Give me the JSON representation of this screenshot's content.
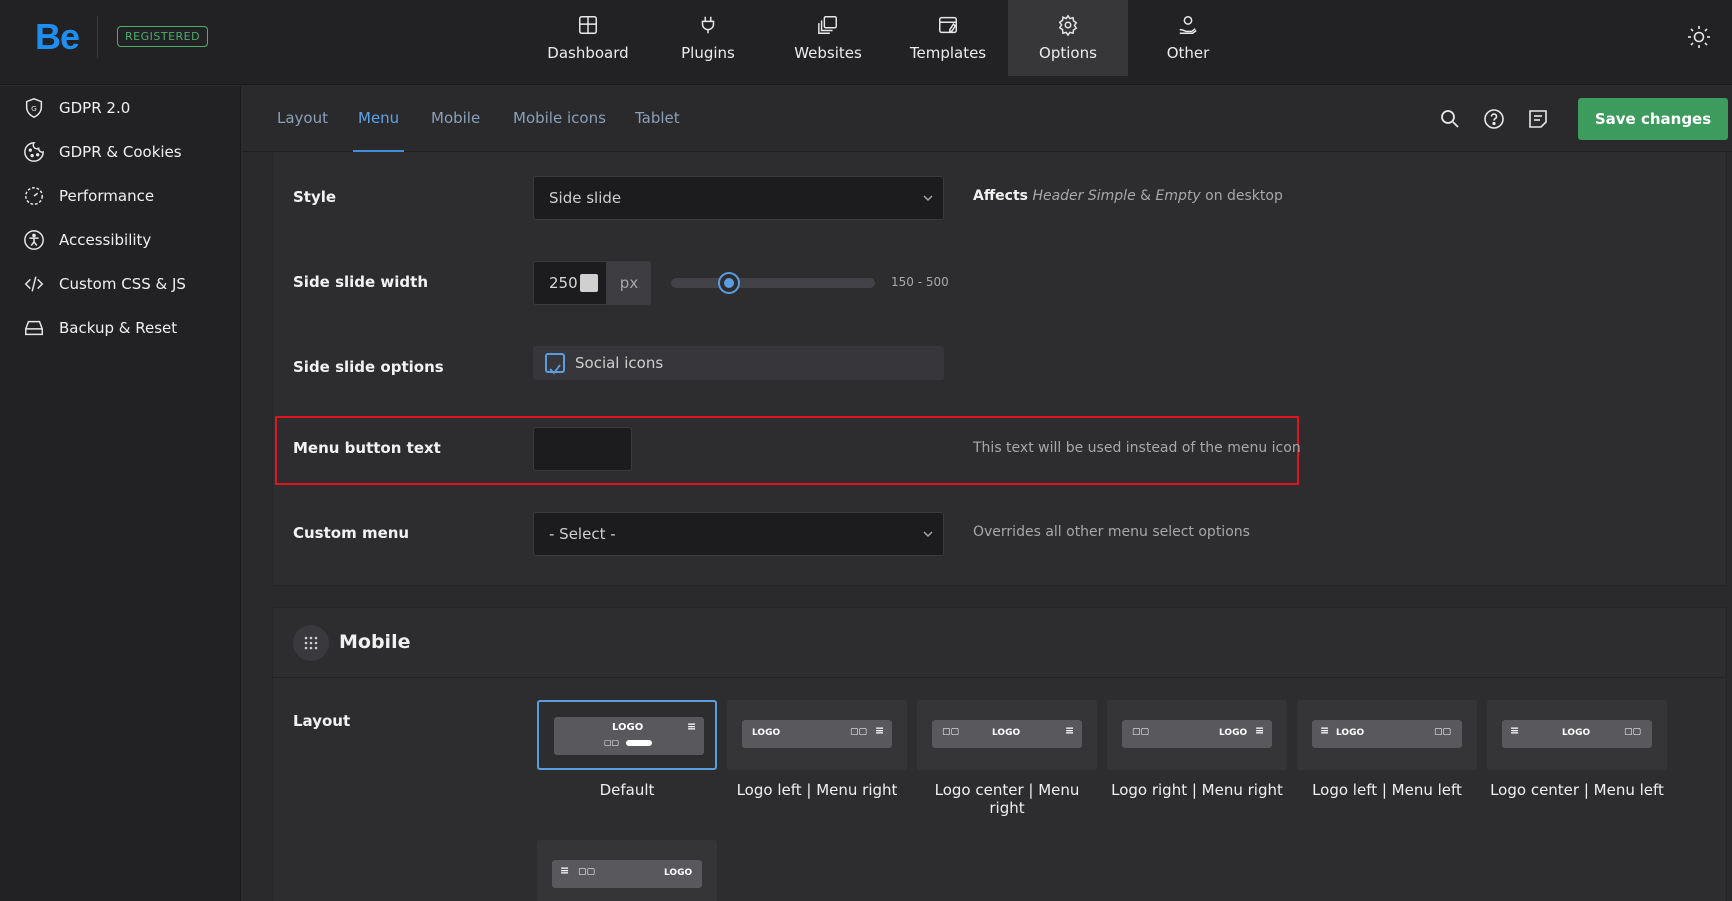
{
  "brand": {
    "logo": "Be",
    "badge": "REGISTERED"
  },
  "nav": [
    {
      "label": "Dashboard",
      "icon": "dashboard-icon"
    },
    {
      "label": "Plugins",
      "icon": "plug-icon"
    },
    {
      "label": "Websites",
      "icon": "websites-icon"
    },
    {
      "label": "Templates",
      "icon": "templates-icon"
    },
    {
      "label": "Options",
      "icon": "gear-icon",
      "active": true
    },
    {
      "label": "Other",
      "icon": "user-hand-icon"
    }
  ],
  "sidebar": [
    {
      "label": "GDPR 2.0",
      "icon": "shield-g-icon"
    },
    {
      "label": "GDPR & Cookies",
      "icon": "cookie-icon"
    },
    {
      "label": "Performance",
      "icon": "gauge-icon"
    },
    {
      "label": "Accessibility",
      "icon": "accessibility-icon"
    },
    {
      "label": "Custom CSS & JS",
      "icon": "code-icon"
    },
    {
      "label": "Backup & Reset",
      "icon": "drive-icon"
    }
  ],
  "tabs": [
    {
      "label": "Layout"
    },
    {
      "label": "Menu",
      "active": true
    },
    {
      "label": "Mobile"
    },
    {
      "label": "Mobile icons"
    },
    {
      "label": "Tablet"
    }
  ],
  "toolbar": {
    "save_label": "Save changes"
  },
  "menu_panel": {
    "style": {
      "label": "Style",
      "value": "Side slide",
      "desc_bold": "Affects",
      "desc_italic": "Header Simple",
      "desc_amp": " & ",
      "desc_italic2": "Empty",
      "desc_tail": " on desktop"
    },
    "width": {
      "label": "Side slide width",
      "value": "250",
      "unit": "px",
      "range": "150 - 500",
      "min": 150,
      "max": 500
    },
    "options": {
      "label": "Side slide options",
      "checkbox_label": "Social icons",
      "checked": true
    },
    "button_text": {
      "label": "Menu button text",
      "value": "",
      "desc": "This text will be used instead of the menu icon"
    },
    "custom_menu": {
      "label": "Custom menu",
      "value": "- Select -",
      "desc": "Overrides all other menu select options"
    }
  },
  "mobile_section": {
    "title": "Mobile",
    "layout_label": "Layout",
    "logo_text": "LOGO",
    "layouts": [
      {
        "label": "Default",
        "selected": true
      },
      {
        "label": "Logo left | Menu right"
      },
      {
        "label": "Logo center | Menu right"
      },
      {
        "label": "Logo right | Menu right"
      },
      {
        "label": "Logo left | Menu left"
      },
      {
        "label": "Logo center | Menu left"
      }
    ]
  },
  "colors": {
    "accent": "#3f8fd8",
    "save": "#3d9b5d",
    "highlight": "#e0141f",
    "badge": "#4caf6d"
  }
}
